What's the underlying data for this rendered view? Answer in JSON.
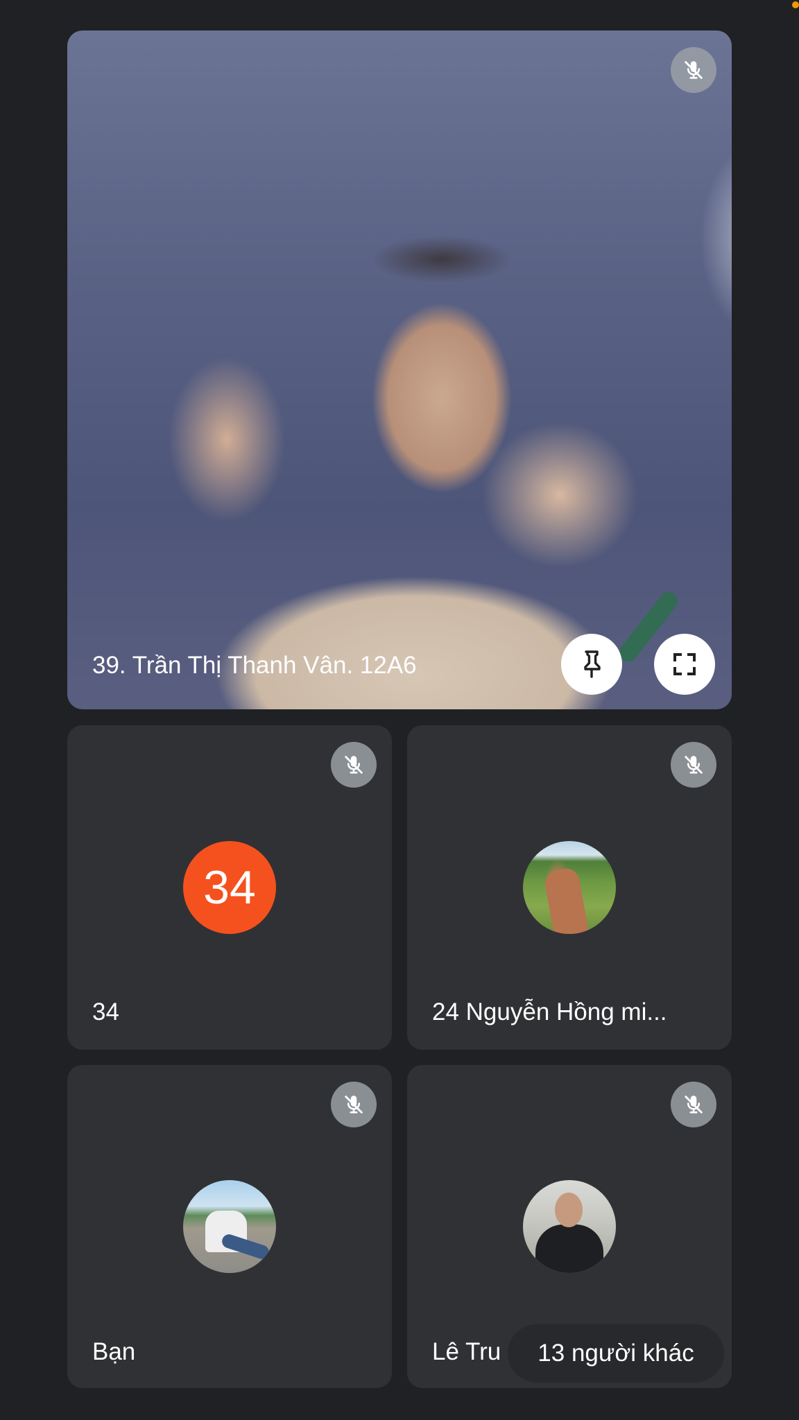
{
  "featured": {
    "name": "39. Trần Thị Thanh Vân. 12A6",
    "muted": true,
    "pin_icon": "pin-icon",
    "fullscreen_icon": "fullscreen-icon"
  },
  "participants": [
    {
      "name": "34",
      "avatar_initial": "34",
      "avatar_color": "#f4511e",
      "muted": true
    },
    {
      "name": "24 Nguyễn Hồng mi...",
      "avatar_photo": "path-landscape",
      "muted": true
    },
    {
      "name": "Bạn",
      "avatar_photo": "person-sitting",
      "muted": true
    },
    {
      "name": "Lê Tru",
      "avatar_photo": "man-in-jacket",
      "muted": true
    }
  ],
  "overflow": {
    "label": "13 người khác"
  },
  "colors": {
    "background": "#202124",
    "tile": "#303134",
    "mute_badge": "#9aa0a6",
    "status_dot": "#f29900"
  }
}
